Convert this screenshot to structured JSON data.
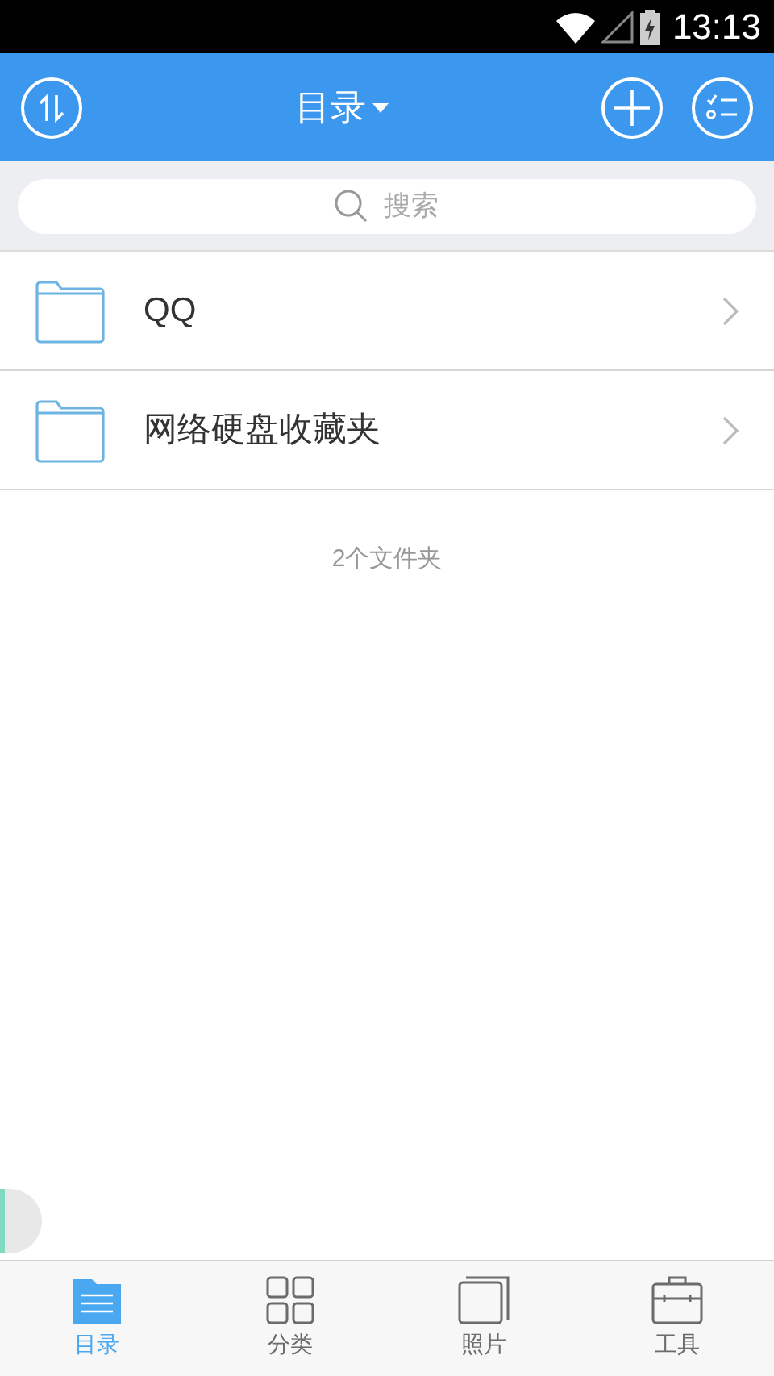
{
  "status_bar": {
    "time": "13:13"
  },
  "header": {
    "title": "目录"
  },
  "search": {
    "placeholder": "搜索"
  },
  "folders": [
    {
      "name": "QQ"
    },
    {
      "name": "网络硬盘收藏夹"
    }
  ],
  "footer_count": "2个文件夹",
  "tabs": [
    {
      "label": "目录",
      "kind": "directory",
      "selected": true
    },
    {
      "label": "分类",
      "kind": "category",
      "selected": false
    },
    {
      "label": "照片",
      "kind": "photos",
      "selected": false
    },
    {
      "label": "工具",
      "kind": "tools",
      "selected": false
    }
  ]
}
